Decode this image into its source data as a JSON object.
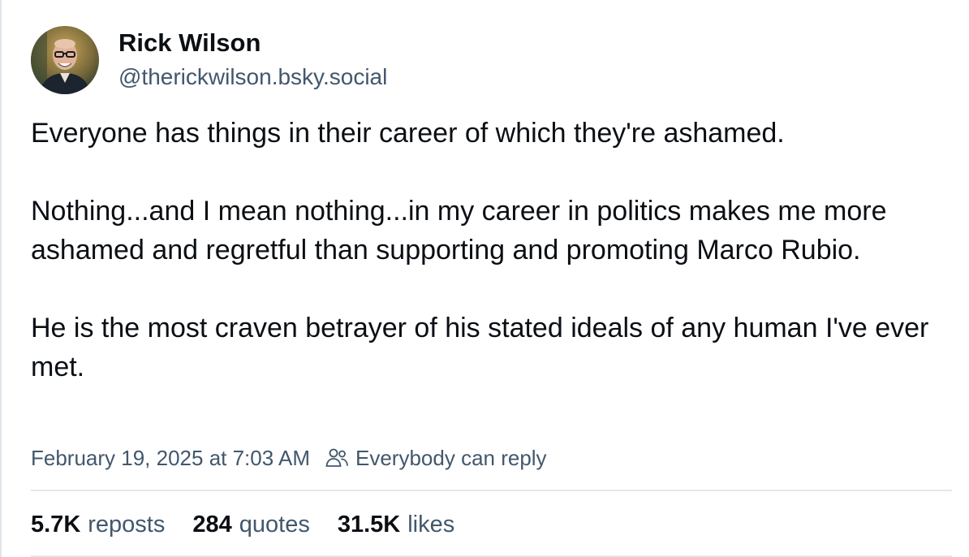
{
  "author": {
    "display_name": "Rick Wilson",
    "handle": "@therickwilson.bsky.social"
  },
  "post": {
    "paragraphs": [
      "Everyone has things in their career of which they're ashamed.",
      "Nothing...and I mean nothing...in my career in politics makes me more ashamed and regretful than supporting and promoting Marco Rubio.",
      "He is the most craven betrayer of his stated ideals of any human I've ever met."
    ]
  },
  "meta": {
    "timestamp": "February 19, 2025 at 7:03 AM",
    "reply_setting": "Everybody can reply",
    "reply_icon": "people-icon"
  },
  "stats": {
    "reposts": {
      "count": "5.7K",
      "label": "reposts"
    },
    "quotes": {
      "count": "284",
      "label": "quotes"
    },
    "likes": {
      "count": "31.5K",
      "label": "likes"
    }
  },
  "colors": {
    "text_primary": "#0b0f14",
    "text_secondary": "#42576c",
    "divider": "#e3e8ee"
  }
}
